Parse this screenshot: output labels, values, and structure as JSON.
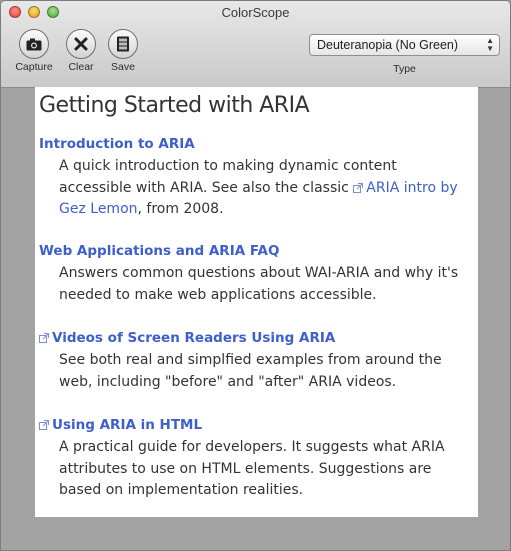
{
  "window": {
    "title": "ColorScope"
  },
  "toolbar": {
    "capture_label": "Capture",
    "clear_label": "Clear",
    "save_label": "Save",
    "type_select_value": "Deuteranopia (No Green)",
    "type_label": "Type"
  },
  "page": {
    "heading": "Getting Started with ARIA",
    "entries": [
      {
        "title": "Introduction to ARIA",
        "desc_before": "A quick introduction to making dynamic content accessible with ARIA. See also the classic",
        "link": "ARIA intro by Gez Lemon",
        "desc_after": ", from 2008."
      },
      {
        "title": "Web Applications and ARIA FAQ",
        "desc": "Answers common questions about WAI-ARIA and why it's needed to make web applications accessible."
      },
      {
        "title": "Videos of Screen Readers Using ARIA",
        "desc": "See both real and simplfied examples from around the web, including \"before\" and \"after\" ARIA videos."
      },
      {
        "title": "Using ARIA in HTML",
        "desc": "A practical guide for developers. It suggests what ARIA attributes to use on HTML elements. Suggestions are based on implementation realities."
      }
    ]
  },
  "colors": {
    "link": "#3e5fc9",
    "text": "#333333"
  }
}
